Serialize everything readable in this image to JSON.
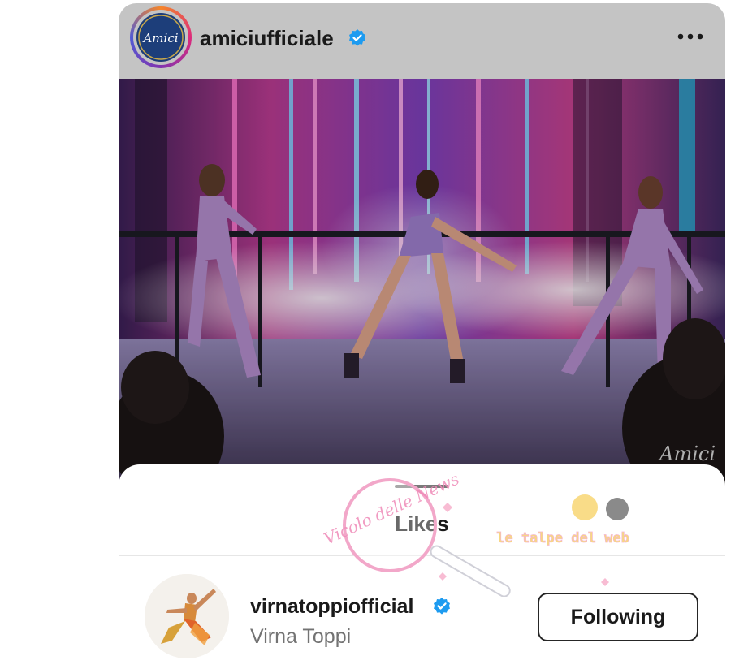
{
  "post": {
    "username": "amiciufficiale",
    "avatar_logo_text": "Amici",
    "verified": true,
    "more_icon": "more-horizontal-icon",
    "photo_watermark": "Amici"
  },
  "likes_sheet": {
    "title": "Likes",
    "users": [
      {
        "username": "virnatoppiofficial",
        "full_name": "Virna Toppi",
        "verified": true,
        "button_label": "Following"
      }
    ]
  },
  "overlay_watermark": {
    "brand": "Vicolo delle News",
    "tagline": "le talpe del web"
  },
  "colors": {
    "verified_blue": "#1d9bf0",
    "header_bg": "#c4c4c4",
    "text_primary": "#1a1a1a",
    "text_secondary": "#737373"
  }
}
